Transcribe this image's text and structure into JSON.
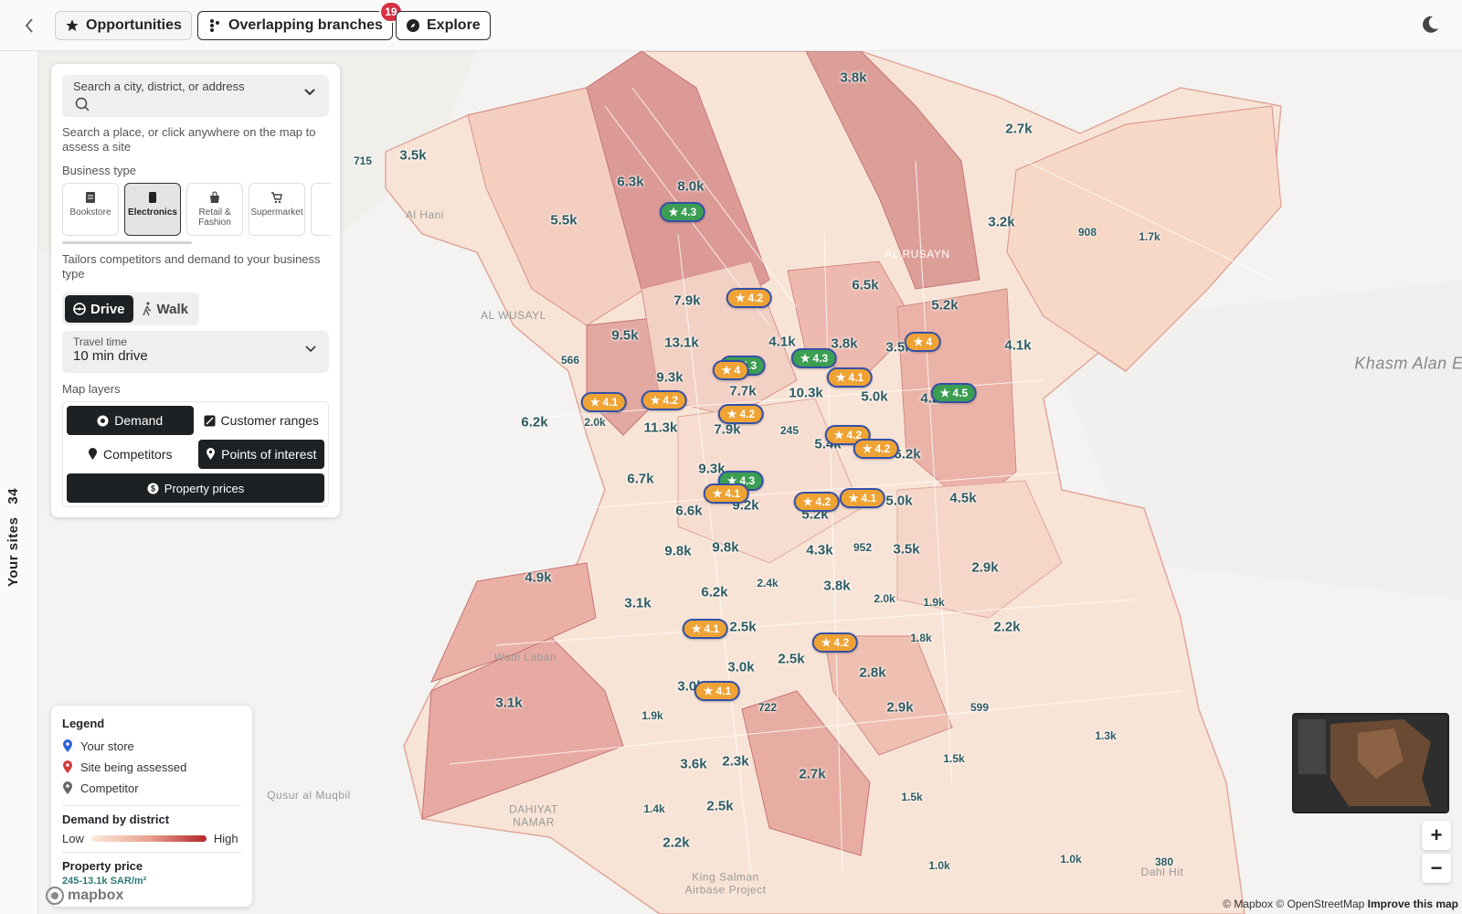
{
  "topbar": {
    "opportunities": "Opportunities",
    "overlapping": "Overlapping branches",
    "overlapping_count": "19",
    "explore": "Explore"
  },
  "rail": {
    "label": "Your sites",
    "count": "34"
  },
  "search": {
    "placeholder": "Search a city, district, or address",
    "help": "Search a place, or click anywhere on the map to assess a site"
  },
  "business": {
    "label": "Business type",
    "types": [
      "Bookstore",
      "Electronics",
      "Retail & Fashion",
      "Supermarket"
    ],
    "selected": "Electronics",
    "help": "Tailors competitors and demand to your business type"
  },
  "modes": {
    "drive": "Drive",
    "walk": "Walk"
  },
  "travel": {
    "label": "Travel time",
    "value": "10 min drive"
  },
  "layers": {
    "label": "Map layers",
    "demand": "Demand",
    "customer_ranges": "Customer ranges",
    "competitors": "Competitors",
    "poi": "Points of interest",
    "property": "Property prices"
  },
  "legend": {
    "title": "Legend",
    "your_store": "Your store",
    "site": "Site being assessed",
    "competitor": "Competitor",
    "demand_title": "Demand by district",
    "low": "Low",
    "high": "High",
    "price_title": "Property price",
    "price_range": "245-13.1k SAR/m²"
  },
  "map": {
    "demand_labels": [
      "3.8k",
      "2.7k",
      "3.5k",
      "6.3k",
      "8.0k",
      "5.5k",
      "3.2k",
      "908",
      "1.7k",
      "6.5k",
      "5.2k",
      "7.9k",
      "9.5k",
      "13.1k",
      "4.1k",
      "3.8k",
      "3.5k",
      "4.1k",
      "566",
      "9.3k",
      "7.7k",
      "10.3k",
      "5.0k",
      "4.2k",
      "6.2k",
      "2.0k",
      "11.3k",
      "7.9k",
      "245",
      "5.4k",
      "6.2k",
      "6.7k",
      "9.3k",
      "9.2k",
      "5.2k",
      "5.0k",
      "4.5k",
      "6.6k",
      "9.8k",
      "9.8k",
      "4.3k",
      "952",
      "3.5k",
      "2.9k",
      "4.9k",
      "3.1k",
      "6.2k",
      "2.4k",
      "3.8k",
      "2.0k",
      "1.9k",
      "2.5k",
      "1.8k",
      "2.2k",
      "3.0k",
      "2.5k",
      "3.0k",
      "2.8k",
      "3.1k",
      "1.9k",
      "722",
      "2.9k",
      "599",
      "1.5k",
      "1.3k",
      "3.6k",
      "2.3k",
      "2.7k",
      "1.5k",
      "1.4k",
      "2.5k",
      "2.2k",
      "1.0k",
      "1.0k",
      "380",
      "715"
    ],
    "places": [
      "Al Hani",
      "AL WUSAYL",
      "AL RUSAYN",
      "Khasm Alan E",
      "Wadi Laban",
      "Qusur al Muqbil",
      "DAHIYAT NAMAR",
      "King Salman Airbase Project",
      "Dahl Hit"
    ],
    "pois": [
      "4.3",
      "4.2",
      "4",
      "4.3",
      "4.1",
      "4.2",
      "4.2",
      "4.3",
      "4.1",
      "4.5",
      "4",
      "4.2",
      "4.2",
      "4.3",
      "4.1",
      "4.2",
      "4.1",
      "4.1",
      "4.2",
      "4.1"
    ]
  },
  "attribution": {
    "text": "© Mapbox © OpenStreetMap",
    "improve": "Improve this map",
    "logo": "mapbox"
  },
  "zoom": {
    "in": "+",
    "out": "−"
  },
  "colors": {
    "primary": "#1d2124",
    "badge": "#d63044",
    "poi_orange": "#efa335",
    "poi_green": "#3c9e52",
    "poi_border": "#3450a8",
    "demand_low": "#fbe9d9",
    "demand_high": "#b3242a",
    "label": "#2d5a60"
  }
}
